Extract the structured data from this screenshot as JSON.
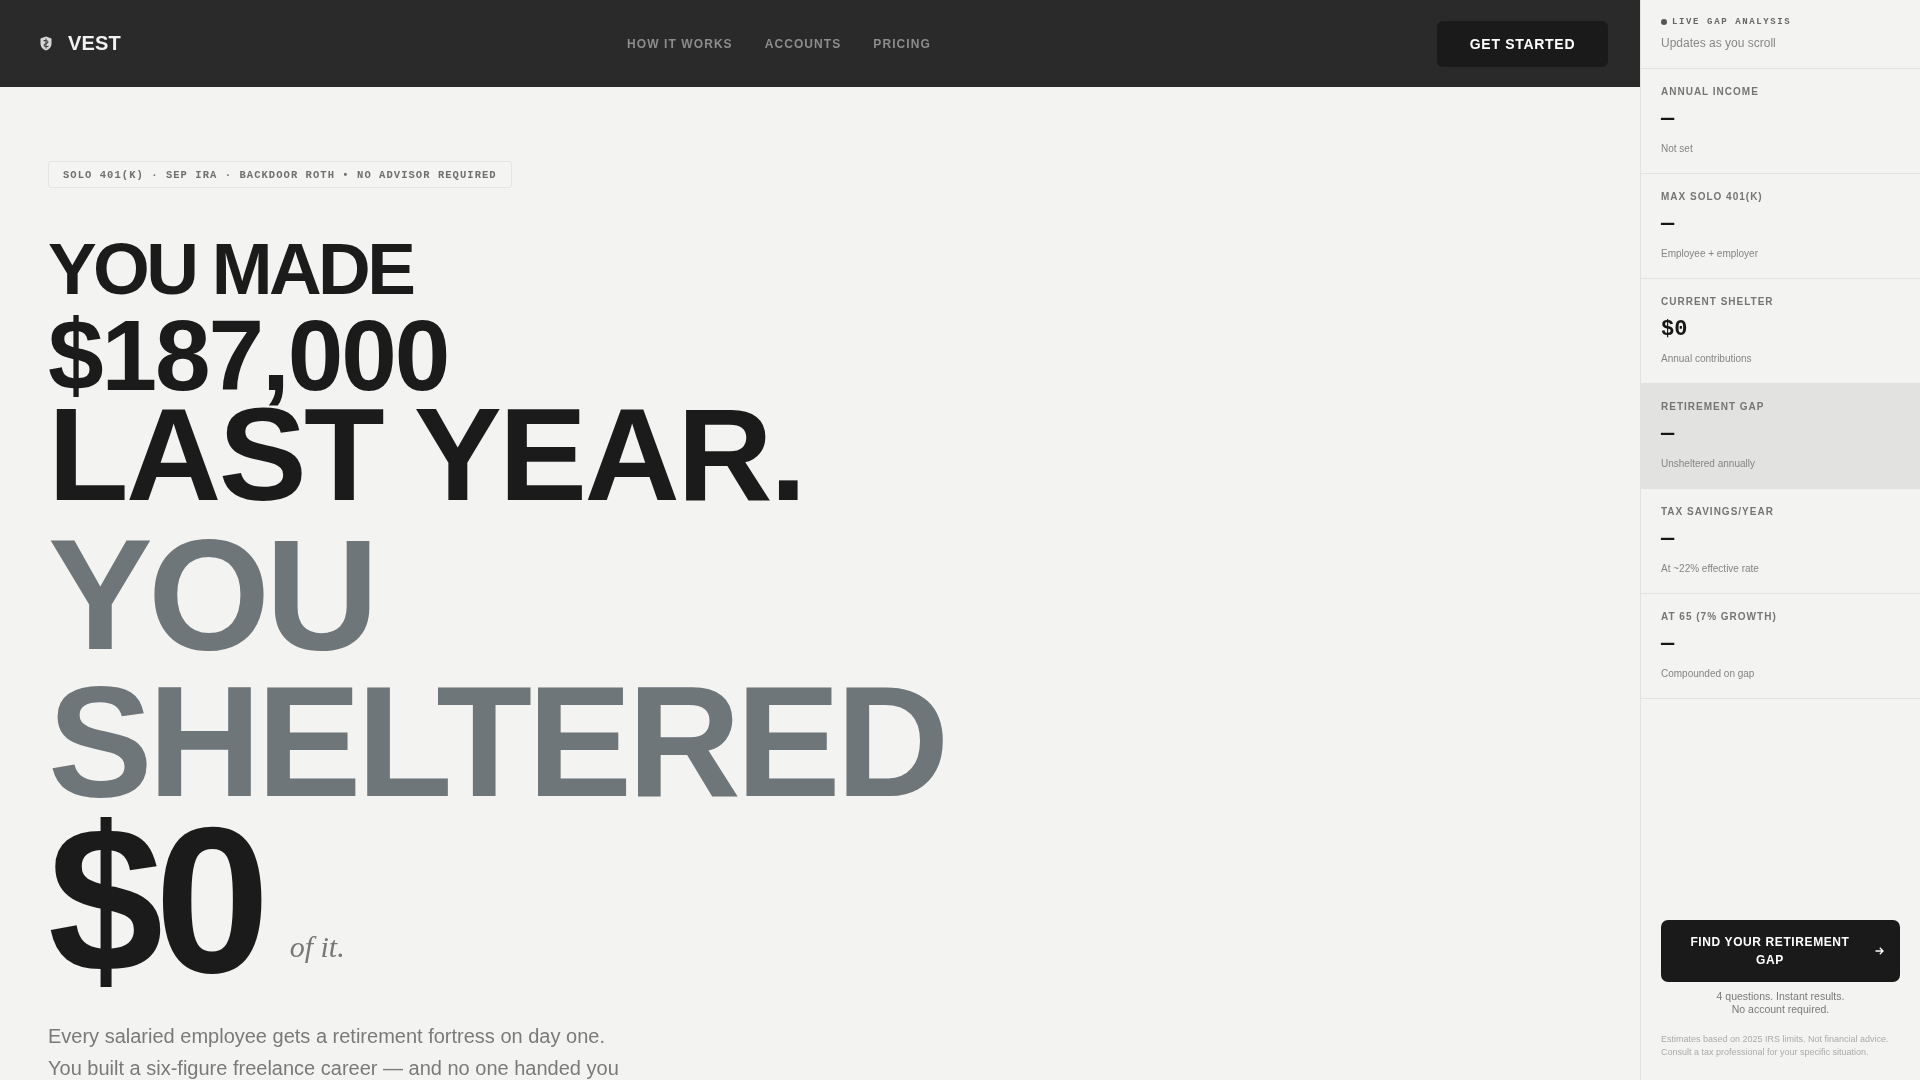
{
  "header": {
    "logo": "VEST",
    "nav": [
      "HOW IT WORKS",
      "ACCOUNTS",
      "PRICING"
    ],
    "cta": "GET STARTED"
  },
  "hero": {
    "badge": "SOLO 401(K) · SEP IRA · BACKDOOR ROTH • NO ADVISOR REQUIRED",
    "headline": [
      {
        "text": "YOU MADE",
        "kind": "lead"
      },
      {
        "text": "$187,000",
        "kind": "amount"
      },
      {
        "text": "LAST YEAR.",
        "kind": "statement"
      },
      {
        "text": "YOU",
        "kind": "muted"
      },
      {
        "text": "SHELTERED",
        "kind": "muted"
      }
    ],
    "zero": {
      "amount": "$0",
      "suffix": "of it."
    },
    "intro": [
      "Every salaried employee gets a retirement fortress on day one.",
      "You built a six-figure freelance career — and no one handed you"
    ]
  },
  "sidebar": {
    "live": {
      "label": "LIVE GAP ANALYSIS",
      "note": "Updates as you scroll"
    },
    "metrics": [
      {
        "label": "ANNUAL INCOME",
        "value": "—",
        "note": "Not set",
        "highlighted": false
      },
      {
        "label": "MAX SOLO 401(K)",
        "value": "—",
        "note": "Employee + employer",
        "highlighted": false
      },
      {
        "label": "CURRENT SHELTER",
        "value": "$0",
        "note": "Annual contributions",
        "highlighted": false
      },
      {
        "label": "RETIREMENT GAP",
        "value": "—",
        "note": "Unsheltered annually",
        "highlighted": true
      },
      {
        "label": "TAX SAVINGS/YEAR",
        "value": "—",
        "note": "At ~22% effective rate",
        "highlighted": false
      },
      {
        "label": "AT 65 (7% GROWTH)",
        "value": "—",
        "note": "Compounded on gap",
        "highlighted": false
      }
    ],
    "cta": "FIND YOUR RETIREMENT GAP",
    "cta_note": [
      "4 questions. Instant results.",
      "No account required."
    ],
    "disclaimer": "Estimates based on 2025 IRS limits. Not financial advice. Consult a tax professional for your specific situation."
  }
}
